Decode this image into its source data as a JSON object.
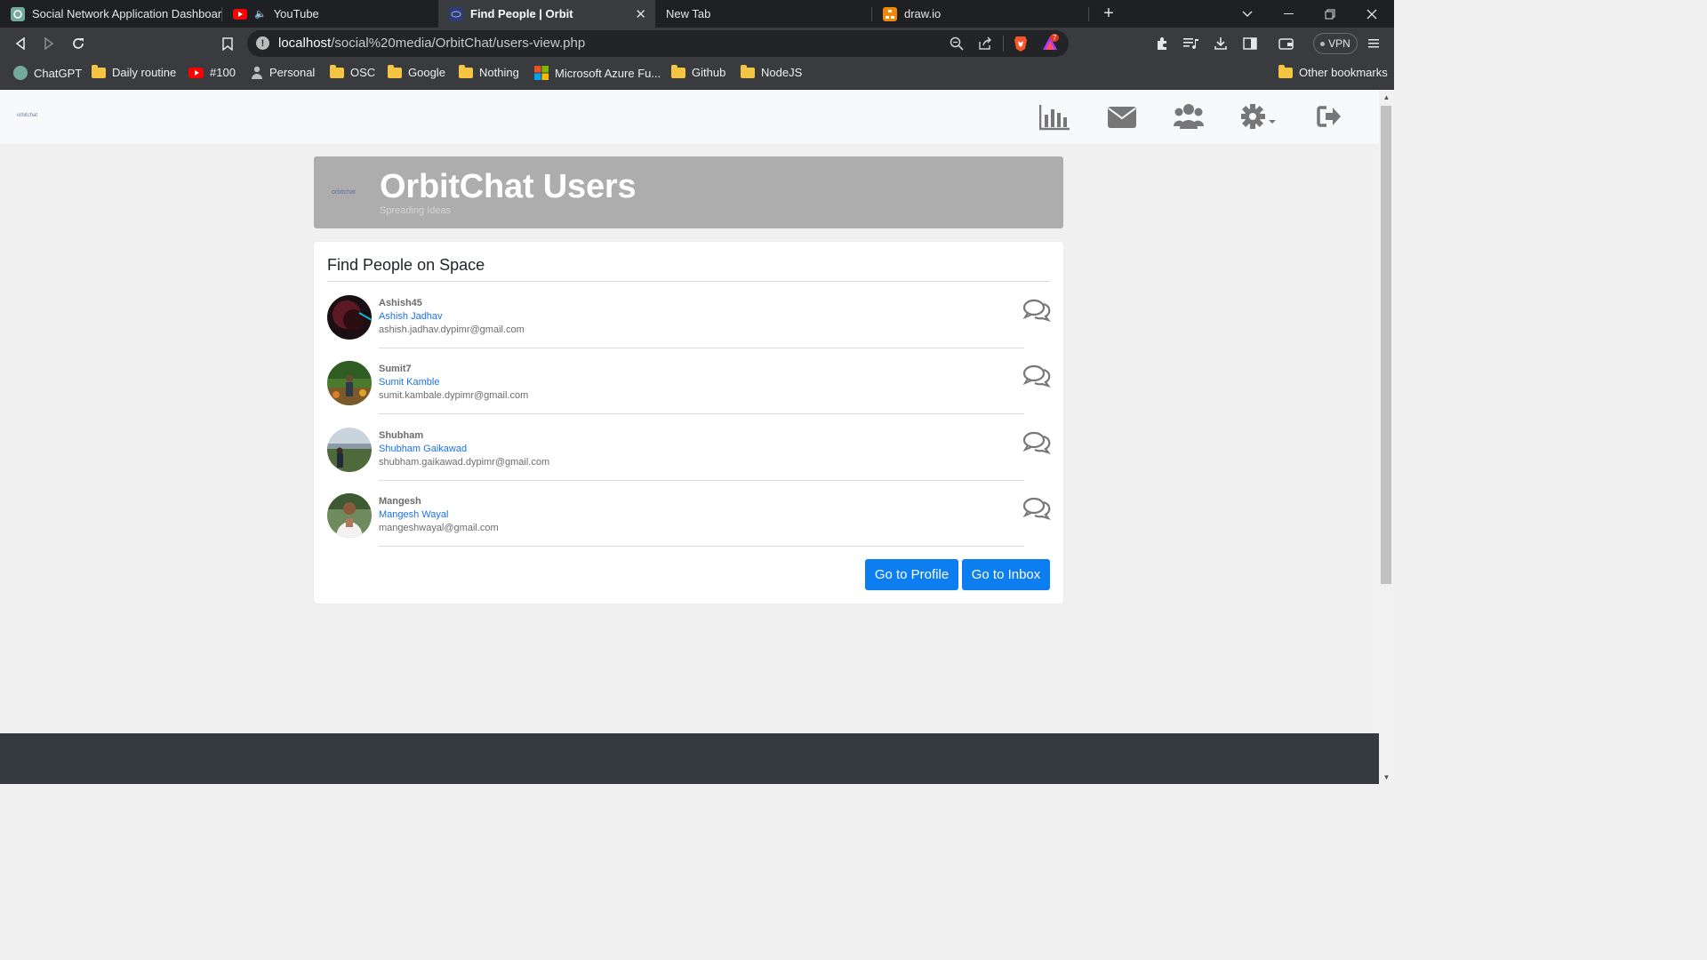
{
  "browser": {
    "tabs": [
      {
        "title": "Social Network Application Dashboard",
        "active": false
      },
      {
        "title": "YouTube",
        "active": false
      },
      {
        "title": "Find People | Orbit",
        "active": true
      },
      {
        "title": "New Tab",
        "active": false
      },
      {
        "title": "draw.io",
        "active": false
      }
    ],
    "url_host": "localhost",
    "url_path": "/social%20media/OrbitChat/users-view.php",
    "vpn_label": "VPN",
    "brave_badge": "7",
    "bookmarks": [
      {
        "label": "ChatGPT",
        "icon": "chatgpt-icon"
      },
      {
        "label": "Daily routine",
        "icon": "folder-icon"
      },
      {
        "label": "#100",
        "icon": "youtube-icon"
      },
      {
        "label": "Personal",
        "icon": "person-icon"
      },
      {
        "label": "OSC",
        "icon": "folder-icon"
      },
      {
        "label": "Google",
        "icon": "folder-icon"
      },
      {
        "label": "Nothing",
        "icon": "folder-icon"
      },
      {
        "label": "Microsoft Azure Fu...",
        "icon": "microsoft-icon"
      },
      {
        "label": "Github",
        "icon": "folder-icon"
      },
      {
        "label": "NodeJS",
        "icon": "folder-icon"
      }
    ],
    "other_bookmarks": "Other bookmarks"
  },
  "navbar": {
    "logo": "orbitchat",
    "icons": [
      "bar-chart-icon",
      "envelope-icon",
      "users-icon",
      "gear-icon",
      "sign-out-icon"
    ]
  },
  "hero": {
    "logo": "orbitchat",
    "title": "OrbitChat Users",
    "subtitle": "Spreading Ideas"
  },
  "card": {
    "title": "Find People on Space",
    "users": [
      {
        "username": "Ashish45",
        "full_name": "Ashish Jadhav",
        "email": "ashish.jadhav.dypimr@gmail.com"
      },
      {
        "username": "Sumit7",
        "full_name": "Sumit Kamble",
        "email": "sumit.kambale.dypimr@gmail.com"
      },
      {
        "username": "Shubham",
        "full_name": "Shubham Gaikawad",
        "email": "shubham.gaikawad.dypimr@gmail.com"
      },
      {
        "username": "Mangesh",
        "full_name": "Mangesh Wayal",
        "email": "mangeshwayal@gmail.com"
      }
    ],
    "profile_button": "Go to Profile",
    "inbox_button": "Go to Inbox"
  },
  "colors": {
    "primary_button": "#0d7ef0",
    "link": "#1a73e8",
    "hero_bg": "#adadad",
    "footer": "#343a40"
  }
}
